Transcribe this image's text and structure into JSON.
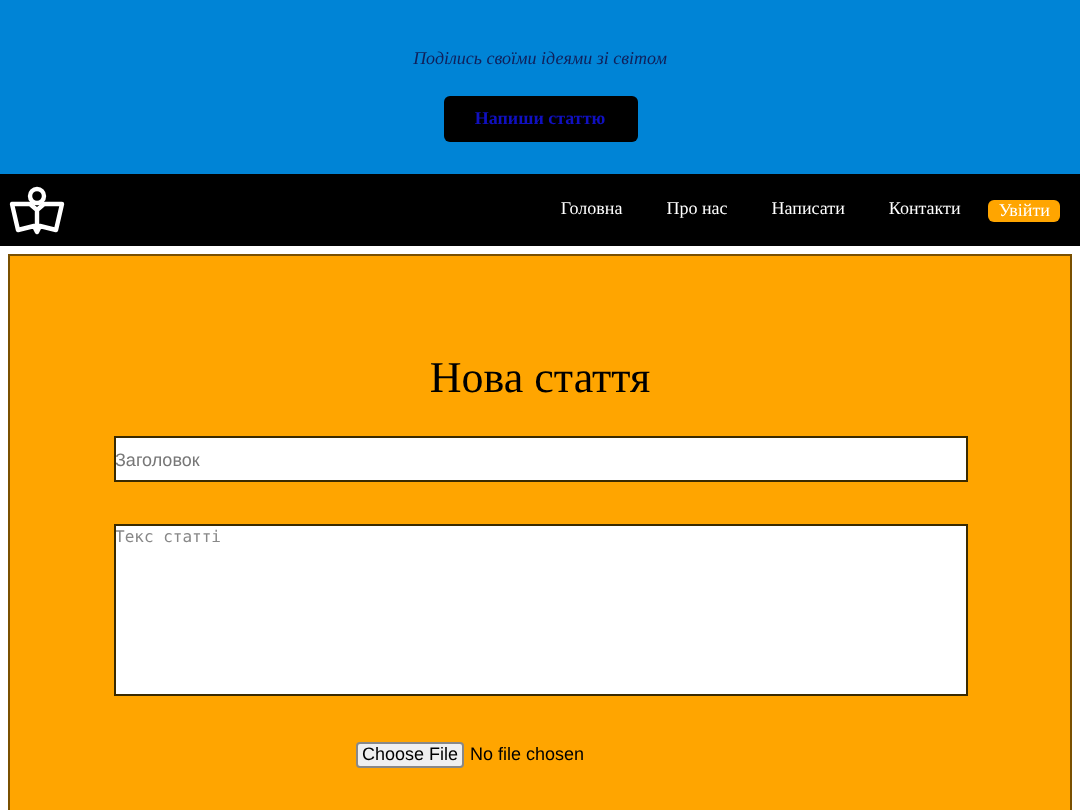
{
  "hero": {
    "tagline": "Поділись своїми ідеями зі світом",
    "cta": "Напиши статтю"
  },
  "nav": {
    "items": [
      {
        "label": "Головна",
        "kind": "link"
      },
      {
        "label": "Про нас",
        "kind": "link"
      },
      {
        "label": "Написати",
        "kind": "link"
      },
      {
        "label": "Контакти",
        "kind": "link"
      },
      {
        "label": "Увійти",
        "kind": "button"
      }
    ]
  },
  "form": {
    "title": "Нова стаття",
    "title_field": {
      "placeholder": "Заголовок"
    },
    "body_field": {
      "placeholder": "Текс статті"
    },
    "file": {
      "button": "Choose File",
      "status": "No file chosen"
    }
  }
}
